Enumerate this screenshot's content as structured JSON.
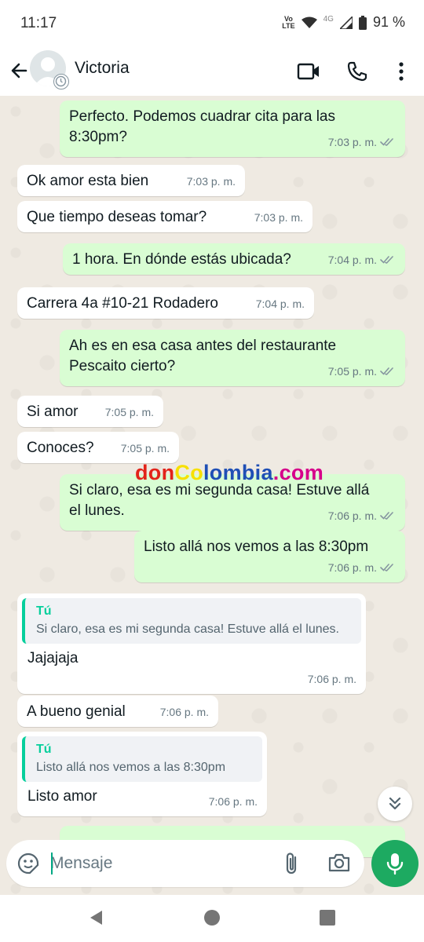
{
  "status_bar": {
    "time": "11:17",
    "volte_top": "Vo",
    "volte_bottom": "LTE",
    "network": "4G",
    "battery": "91 %"
  },
  "header": {
    "contact_name": "Victoria"
  },
  "messages": [
    {
      "dir": "out",
      "text": "Perfecto. Podemos cuadrar cita para las 8:30pm?",
      "time": "7:03 p. m."
    },
    {
      "dir": "in",
      "text": "Ok amor esta bien",
      "time": "7:03 p. m."
    },
    {
      "dir": "in",
      "text": "Que tiempo deseas tomar?",
      "time": "7:03 p. m."
    },
    {
      "dir": "out",
      "text": "1 hora. En dónde estás ubicada?",
      "time": "7:04 p. m."
    },
    {
      "dir": "in",
      "text": "Carrera 4a #10-21 Rodadero",
      "time": "7:04 p. m."
    },
    {
      "dir": "out",
      "text": "Ah es en esa casa antes del restaurante Pescaito cierto?",
      "time": "7:05 p. m."
    },
    {
      "dir": "in",
      "text": "Si amor",
      "time": "7:05 p. m."
    },
    {
      "dir": "in",
      "text": "Conoces?",
      "time": "7:05 p. m."
    },
    {
      "dir": "out",
      "text": "Si claro, esa es mi segunda casa! Estuve allá el lunes.",
      "time": "7:06 p. m."
    },
    {
      "dir": "out",
      "text": "Listo allá nos vemos a las 8:30pm",
      "time": "7:06 p. m."
    },
    {
      "dir": "in",
      "quote_name": "Tú",
      "quote_text": "Si claro, esa es mi segunda casa! Estuve allá el lunes.",
      "text": "Jajajaja",
      "time": "7:06 p. m."
    },
    {
      "dir": "in",
      "text": "A bueno genial",
      "time": "7:06 p. m."
    },
    {
      "dir": "in",
      "quote_name": "Tú",
      "quote_text": "Listo allá nos vemos a las 8:30pm",
      "text": "Listo amor",
      "time": "7:06 p. m."
    }
  ],
  "watermark": {
    "part1": "don",
    "part2": "Co",
    "part3": "lombia",
    "part4": ".com"
  },
  "composer": {
    "placeholder": "Mensaje"
  },
  "colors": {
    "outgoing_bubble": "#d9fdd3",
    "incoming_bubble": "#ffffff",
    "chat_background": "#efeae2",
    "accent_green": "#1daa61",
    "quote_bar": "#06cf9c",
    "read_ticks": "#8696a0"
  },
  "icons": [
    "back-arrow-icon",
    "video-call-icon",
    "phone-icon",
    "more-vertical-icon",
    "double-check-icon",
    "sticker-icon",
    "attach-icon",
    "camera-icon",
    "mic-icon",
    "chevrons-down-icon",
    "nav-back-icon",
    "nav-home-icon",
    "nav-recents-icon"
  ]
}
